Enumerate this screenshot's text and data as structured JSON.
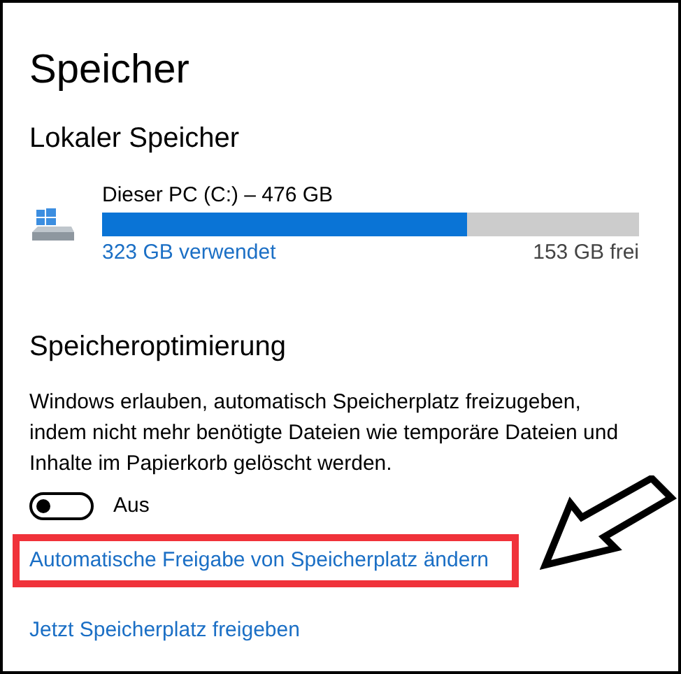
{
  "title": "Speicher",
  "local_storage": {
    "heading": "Lokaler Speicher",
    "drive": {
      "name": "Dieser PC (C:) – 476 GB",
      "level": 0.68,
      "used": "323 GB verwendet",
      "free": "153 GB frei"
    }
  },
  "storage_sense": {
    "heading": "Speicheroptimierung",
    "description": "Windows erlauben, automatisch Speicherplatz freizugeben, indem nicht mehr benötigte Dateien wie temporäre Dateien und Inhalte im Papierkorb gelöscht werden.",
    "toggle": {
      "on": false,
      "label": "Aus"
    },
    "links": [
      {
        "label": "Automatische Freigabe von Speicherplatz ändern",
        "highlighted": true
      },
      {
        "label": "Jetzt Speicherplatz freigeben",
        "highlighted": false
      }
    ]
  }
}
